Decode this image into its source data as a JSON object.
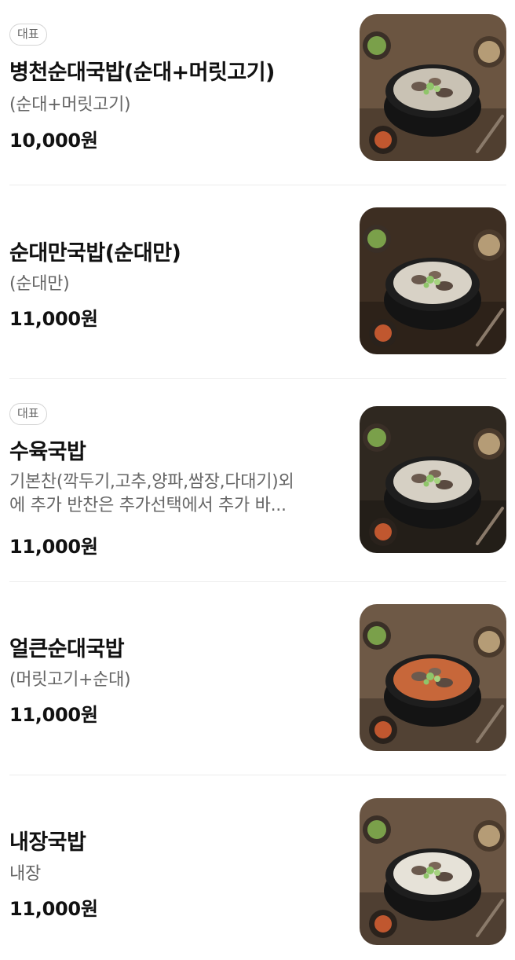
{
  "menu": {
    "items": [
      {
        "badge": "대표",
        "name": "병천순대국밥(순대+머릿고기)",
        "desc_lines": [
          "(순대+머릿고기)"
        ],
        "price": "10,000원",
        "image_icon": "soup-bowl-photo",
        "soup_color": "#c9c2b4",
        "table_color": "#6b5541"
      },
      {
        "badge": "",
        "name": "순대만국밥(순대만)",
        "desc_lines": [
          "(순대만)"
        ],
        "price": "11,000원",
        "image_icon": "soup-bowl-photo",
        "soup_color": "#d8d2c6",
        "table_color": "#3d2e22"
      },
      {
        "badge": "대표",
        "name": "수육국밥",
        "desc_lines": [
          "기본찬(깍두기,고추,양파,쌈장,다대기)외",
          "에 추가 반찬은 추가선택에서 추가 바..."
        ],
        "price": "11,000원",
        "image_icon": "soup-bowl-photo",
        "soup_color": "#d6d0c4",
        "table_color": "#2f2820"
      },
      {
        "badge": "",
        "name": "얼큰순대국밥",
        "desc_lines": [
          "(머릿고기+순대)"
        ],
        "price": "11,000원",
        "image_icon": "spicy-soup-bowl-photo",
        "soup_color": "#c7673a",
        "table_color": "#6e5946"
      },
      {
        "badge": "",
        "name": "내장국밥",
        "desc_lines": [
          "내장"
        ],
        "price": "11,000원",
        "image_icon": "soup-bowl-photo",
        "soup_color": "#e6e2d8",
        "table_color": "#6a5543"
      }
    ]
  }
}
